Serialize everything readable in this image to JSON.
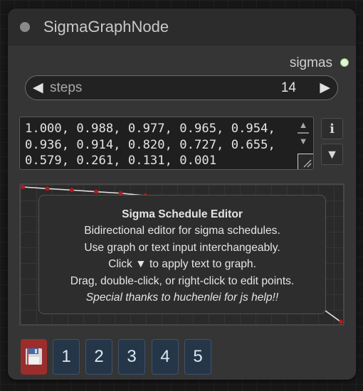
{
  "node": {
    "title": "SigmaGraphNode",
    "output": {
      "label": "sigmas",
      "dot_color": "#ddf7cf"
    }
  },
  "steps": {
    "label": "steps",
    "value": "14",
    "decrement_icon": "triangle-left",
    "increment_icon": "triangle-right"
  },
  "sigma_text": {
    "value": "1.000, 0.988, 0.977, 0.965, 0.954,\n0.936, 0.914, 0.820, 0.727, 0.655,\n0.579, 0.261, 0.131, 0.001"
  },
  "side_buttons": {
    "info_label": "i",
    "apply_label": "▼"
  },
  "info_box": {
    "title": "Sigma Schedule Editor",
    "line1": "Bidirectional editor for sigma schedules.",
    "line2": "Use graph or text input interchangeably.",
    "line3": "Click ▼ to apply text to graph.",
    "line4": "Drag, double-click, or right-click to edit points.",
    "line5": "Special thanks to huchenlei for js help!!"
  },
  "graph": {
    "sigmas": [
      1.0,
      0.988,
      0.977,
      0.965,
      0.954,
      0.936,
      0.914,
      0.82,
      0.727,
      0.655,
      0.579,
      0.261,
      0.131,
      0.001
    ],
    "line_color": "#e0e0e0",
    "point_color": "#b3191f"
  },
  "bottom_buttons": {
    "save_icon": "floppy-disk",
    "save_color": "#9b2d2d",
    "slots": [
      "1",
      "2",
      "3",
      "4",
      "5"
    ]
  }
}
